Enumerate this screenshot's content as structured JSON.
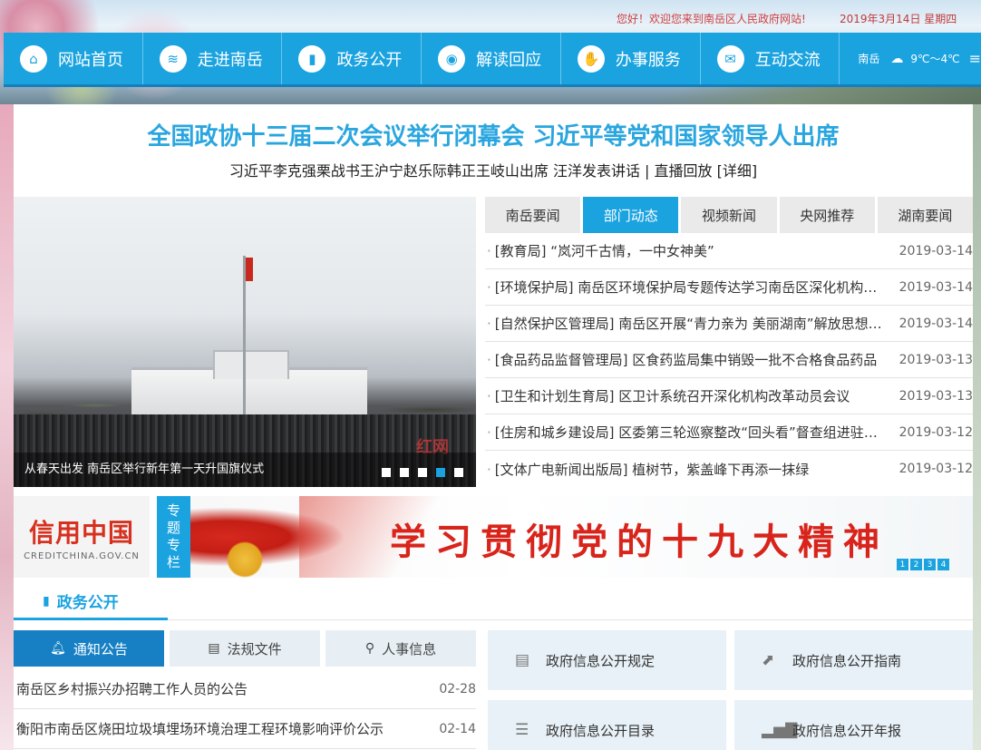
{
  "header": {
    "welcome": "您好！欢迎您来到南岳区人民政府网站!",
    "date": "2019年3月14日  星期四"
  },
  "nav": {
    "items": [
      {
        "label": "网站首页",
        "icon": "home-icon"
      },
      {
        "label": "走进南岳",
        "icon": "layers-icon"
      },
      {
        "label": "政务公开",
        "icon": "document-icon"
      },
      {
        "label": "解读回应",
        "icon": "chat-icon"
      },
      {
        "label": "办事服务",
        "icon": "thumbs-up-icon"
      },
      {
        "label": "互动交流",
        "icon": "message-icon"
      }
    ],
    "weather": {
      "city": "南岳",
      "temp": "9℃～4℃",
      "icon": "cloud-icon"
    }
  },
  "headline": {
    "title": "全国政协十三届二次会议举行闭幕会 习近平等党和国家领导人出席",
    "subtitle": "习近平李克强栗战书王沪宁赵乐际韩正王岐山出席 汪洋发表讲话 | 直播回放 [详细]"
  },
  "slider": {
    "caption": "从春天出发 南岳区举行新年第一天升国旗仪式",
    "watermark": "红网",
    "active_index": 3,
    "count": 5
  },
  "news_tabs": [
    "南岳要闻",
    "部门动态",
    "视频新闻",
    "央网推荐",
    "湖南要闻"
  ],
  "news_active_tab": 1,
  "news": [
    {
      "title": "[教育局] “岚河千古情，一中女神美”",
      "date": "2019-03-14"
    },
    {
      "title": "[环境保护局] 南岳区环境保护局专题传达学习南岳区深化机构改革动员会议精神",
      "date": "2019-03-14"
    },
    {
      "title": "[自然保护区管理局] 南岳区开展“青力亲为 美丽湖南”解放思想大讨论活动",
      "date": "2019-03-14"
    },
    {
      "title": "[食品药品监督管理局] 区食药监局集中销毁一批不合格食品药品",
      "date": "2019-03-13"
    },
    {
      "title": "[卫生和计划生育局] 区卫计系统召开深化机构改革动员会议",
      "date": "2019-03-13"
    },
    {
      "title": "[住房和城乡建设局] 区委第三轮巡察整改“回头看”督查组进驻区住建局",
      "date": "2019-03-12"
    },
    {
      "title": "[文体广电新闻出版局] 植树节，紫盖峰下再添一抹绿",
      "date": "2019-03-12"
    }
  ],
  "credit": {
    "title": "信用中国",
    "url": "CREDITCHINA.GOV.CN"
  },
  "banner": {
    "label_chars": [
      "专",
      "题",
      "专",
      "栏"
    ],
    "slogan": "学习贯彻党的十九大精神",
    "pages": [
      "1",
      "2",
      "3",
      "4"
    ],
    "active_page": 1
  },
  "section": {
    "title": "政务公开",
    "icon": "document-icon"
  },
  "sub_tabs": [
    {
      "label": "通知公告",
      "icon": "bell-icon"
    },
    {
      "label": "法规文件",
      "icon": "folder-icon"
    },
    {
      "label": "人事信息",
      "icon": "badge-icon"
    }
  ],
  "sub_active_tab": 0,
  "notices": [
    {
      "title": "南岳区乡村振兴办招聘工作人员的公告",
      "date": "02-28"
    },
    {
      "title": "衡阳市南岳区烧田垃圾填埋场环境治理工程环境影响评价公示",
      "date": "02-14"
    }
  ],
  "info_boxes": [
    {
      "label": "政府信息公开规定",
      "icon": "list-doc-icon"
    },
    {
      "label": "政府信息公开指南",
      "icon": "compass-icon"
    },
    {
      "label": "政府信息公开目录",
      "icon": "list-icon"
    },
    {
      "label": "政府信息公开年报",
      "icon": "bar-chart-icon"
    }
  ],
  "colors": {
    "accent": "#1ba3e0",
    "accent_dark": "#1780c4",
    "headline": "#2aa6df",
    "slogan": "#d8241b"
  }
}
